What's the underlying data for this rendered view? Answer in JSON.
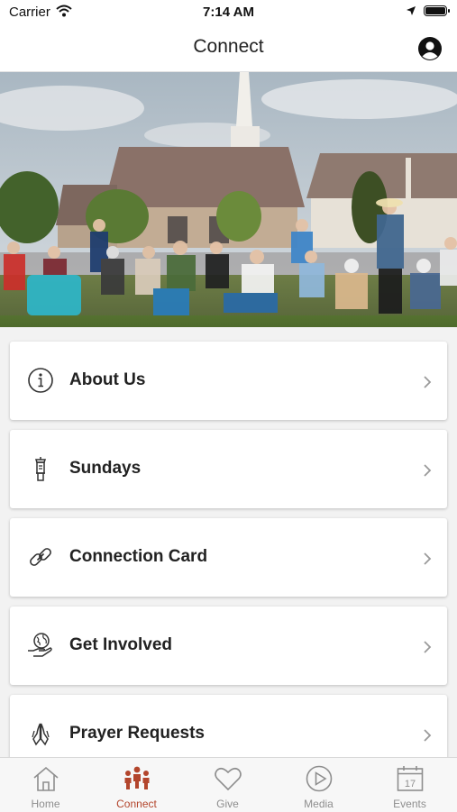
{
  "status_bar": {
    "carrier": "Carrier",
    "time": "7:14 AM"
  },
  "header": {
    "title": "Connect",
    "profile_icon": "person-circle-icon"
  },
  "hero": {
    "icon": "church-congregation-photo"
  },
  "menu": [
    {
      "label": "About Us",
      "icon": "info-icon"
    },
    {
      "label": "Sundays",
      "icon": "lantern-icon"
    },
    {
      "label": "Connection Card",
      "icon": "link-icon"
    },
    {
      "label": "Get Involved",
      "icon": "globe-hand-icon"
    },
    {
      "label": "Prayer Requests",
      "icon": "praying-hands-icon"
    }
  ],
  "tabs": [
    {
      "label": "Home",
      "icon": "home-icon"
    },
    {
      "label": "Connect",
      "icon": "people-icon",
      "active": true
    },
    {
      "label": "Give",
      "icon": "heart-icon"
    },
    {
      "label": "Media",
      "icon": "play-icon"
    },
    {
      "label": "Events",
      "icon": "calendar-icon",
      "badge": "17"
    }
  ],
  "colors": {
    "accent": "#b3452c",
    "inactive": "#8e8e8e"
  }
}
